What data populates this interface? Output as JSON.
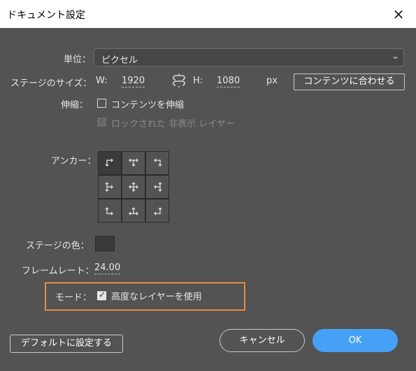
{
  "window": {
    "title": "ドキュメント設定",
    "close_icon": "×"
  },
  "units": {
    "label": "単位：",
    "value": "ピクセル"
  },
  "stage_size": {
    "label": "ステージのサイズ：",
    "w_label": "W:",
    "w_value": "1920",
    "h_label": "H:",
    "h_value": "1080",
    "unit": "px",
    "fit_button": "コンテンツに合わせる"
  },
  "scale": {
    "label": "伸縮：",
    "scale_content": "コンテンツを伸縮",
    "locked_hidden": "ロックされた 非表示 レイヤー"
  },
  "anchor": {
    "label": "アンカー：",
    "selected": "top-left"
  },
  "stage_color": {
    "label": "ステージの色：",
    "color": "#3a3a3a"
  },
  "frame_rate": {
    "label": "フレームレート：",
    "value": "24.00"
  },
  "mode": {
    "label": "モード：",
    "advanced_layers": "高度なレイヤーを使用",
    "checked": true
  },
  "buttons": {
    "default": "デフォルトに設定する",
    "cancel": "キャンセル",
    "ok": "OK"
  },
  "colors": {
    "ok_button": "#46a0f5",
    "highlight": "#e58b43",
    "background": "#535353"
  }
}
